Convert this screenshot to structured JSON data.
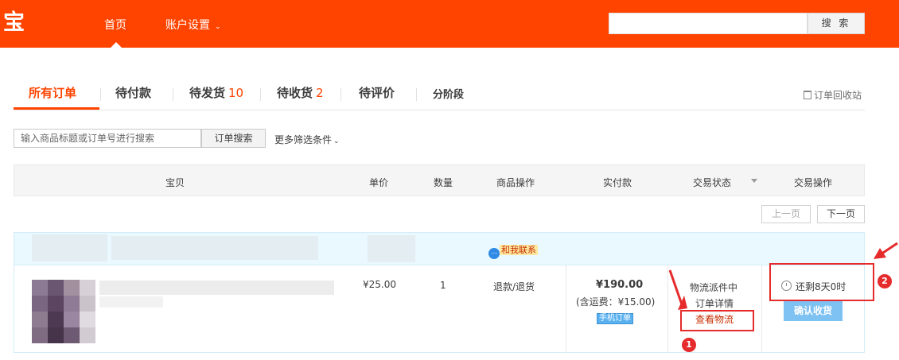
{
  "header": {
    "logo": "宝",
    "nav_home": "首页",
    "nav_account": "账户设置",
    "search_button": "搜 索",
    "brand_color": "#ff4400"
  },
  "tabs": [
    {
      "label": "所有订单",
      "count": ""
    },
    {
      "label": "待付款",
      "count": ""
    },
    {
      "label": "待发货",
      "count": "10"
    },
    {
      "label": "待收货",
      "count": "2"
    },
    {
      "label": "待评价",
      "count": ""
    },
    {
      "label": "分阶段",
      "count": ""
    }
  ],
  "recycle_bin": "订单回收站",
  "filter": {
    "placeholder": "输入商品标题或订单号进行搜索",
    "search_button": "订单搜索",
    "more_filters": "更多筛选条件"
  },
  "table_header": {
    "item": "宝贝",
    "unit_price": "单价",
    "quantity": "数量",
    "item_action": "商品操作",
    "paid": "实付款",
    "status": "交易状态",
    "action": "交易操作"
  },
  "pager": {
    "prev": "上一页",
    "next": "下一页"
  },
  "order": {
    "contact": "和我联系",
    "unit_price": "¥25.00",
    "quantity": "1",
    "item_action": "退款/退货",
    "paid": "¥190.00",
    "shipping": "(含运费：¥15.00)",
    "mobile_badge": "手机订单",
    "status": "物流派件中",
    "order_detail": "订单详情",
    "view_logistics": "查看物流",
    "remaining_time": "还剩8天0时",
    "confirm_receipt": "确认收货"
  },
  "annotations": {
    "badge1": "1",
    "badge2": "2",
    "color": "#e52b2b"
  }
}
